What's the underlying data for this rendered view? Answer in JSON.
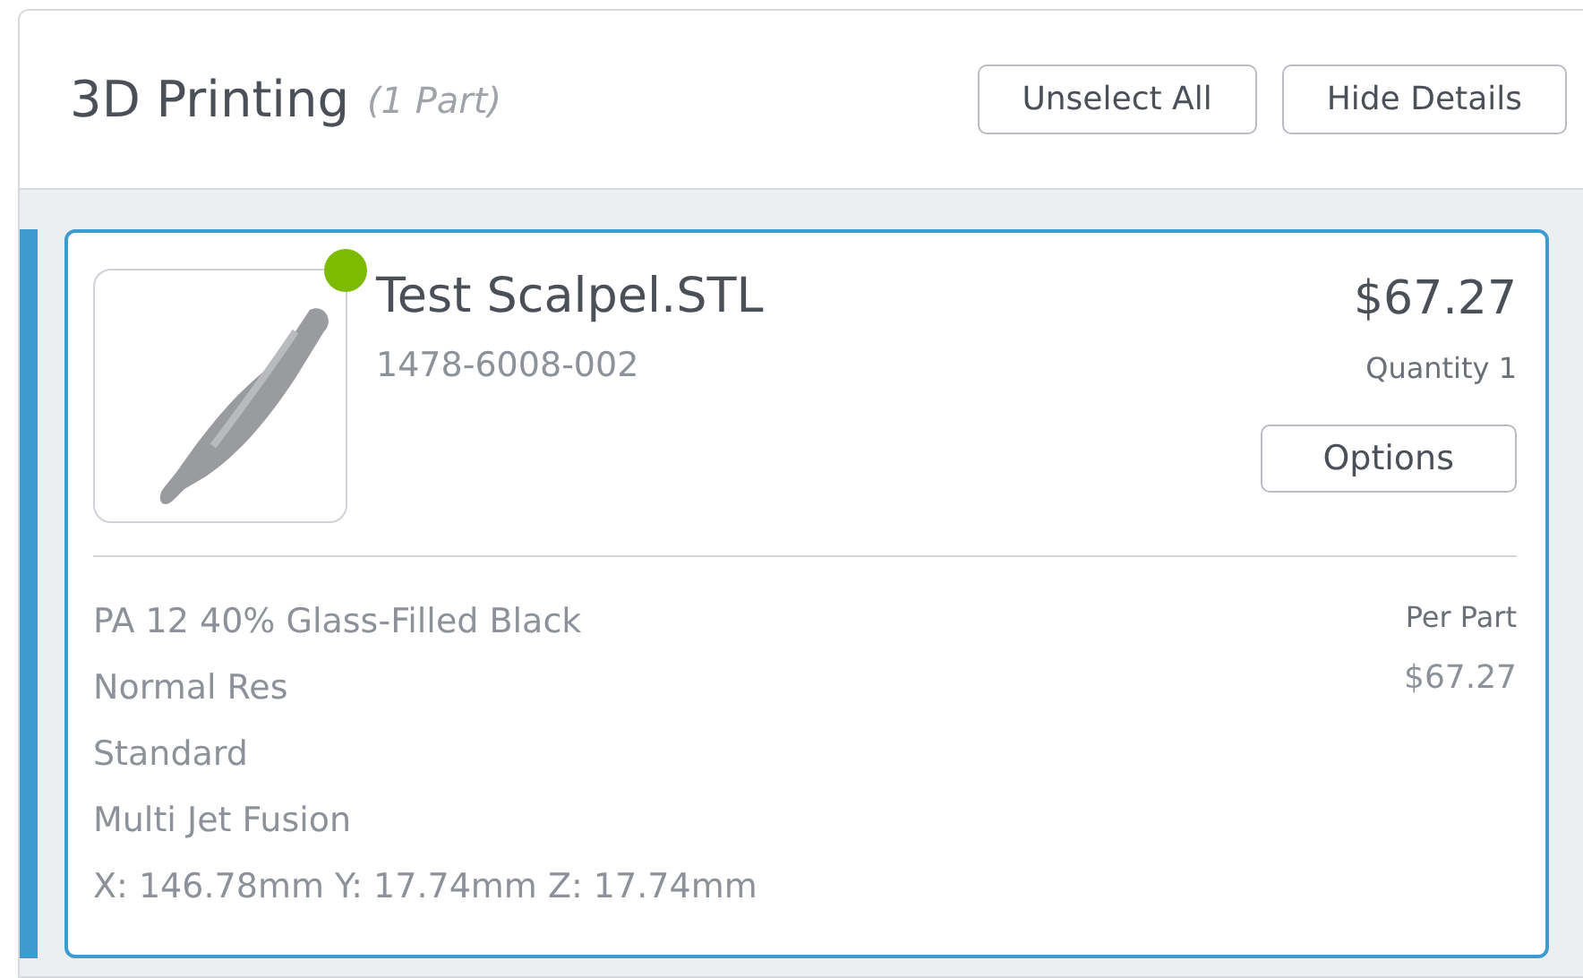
{
  "section": {
    "title": "3D Printing",
    "count": "(1 Part)"
  },
  "buttons": [
    "Unselect All",
    "Hide Details"
  ],
  "parts": [
    {
      "selected": true,
      "color": "#7cbb00",
      "name": "Test Scalpel.STL",
      "number": "1478-6008-002",
      "price": "$67.27",
      "quantity": "Quantity 1",
      "options": "Options",
      "details": [
        "PA 12 40% Glass-Filled Black",
        "Normal Res",
        "Standard",
        "Multi Jet Fusion",
        "X: 146.78mm Y: 17.74mm Z: 17.74mm"
      ],
      "per_part_label": "Per Part",
      "per_part_price": "$67.27"
    }
  ]
}
